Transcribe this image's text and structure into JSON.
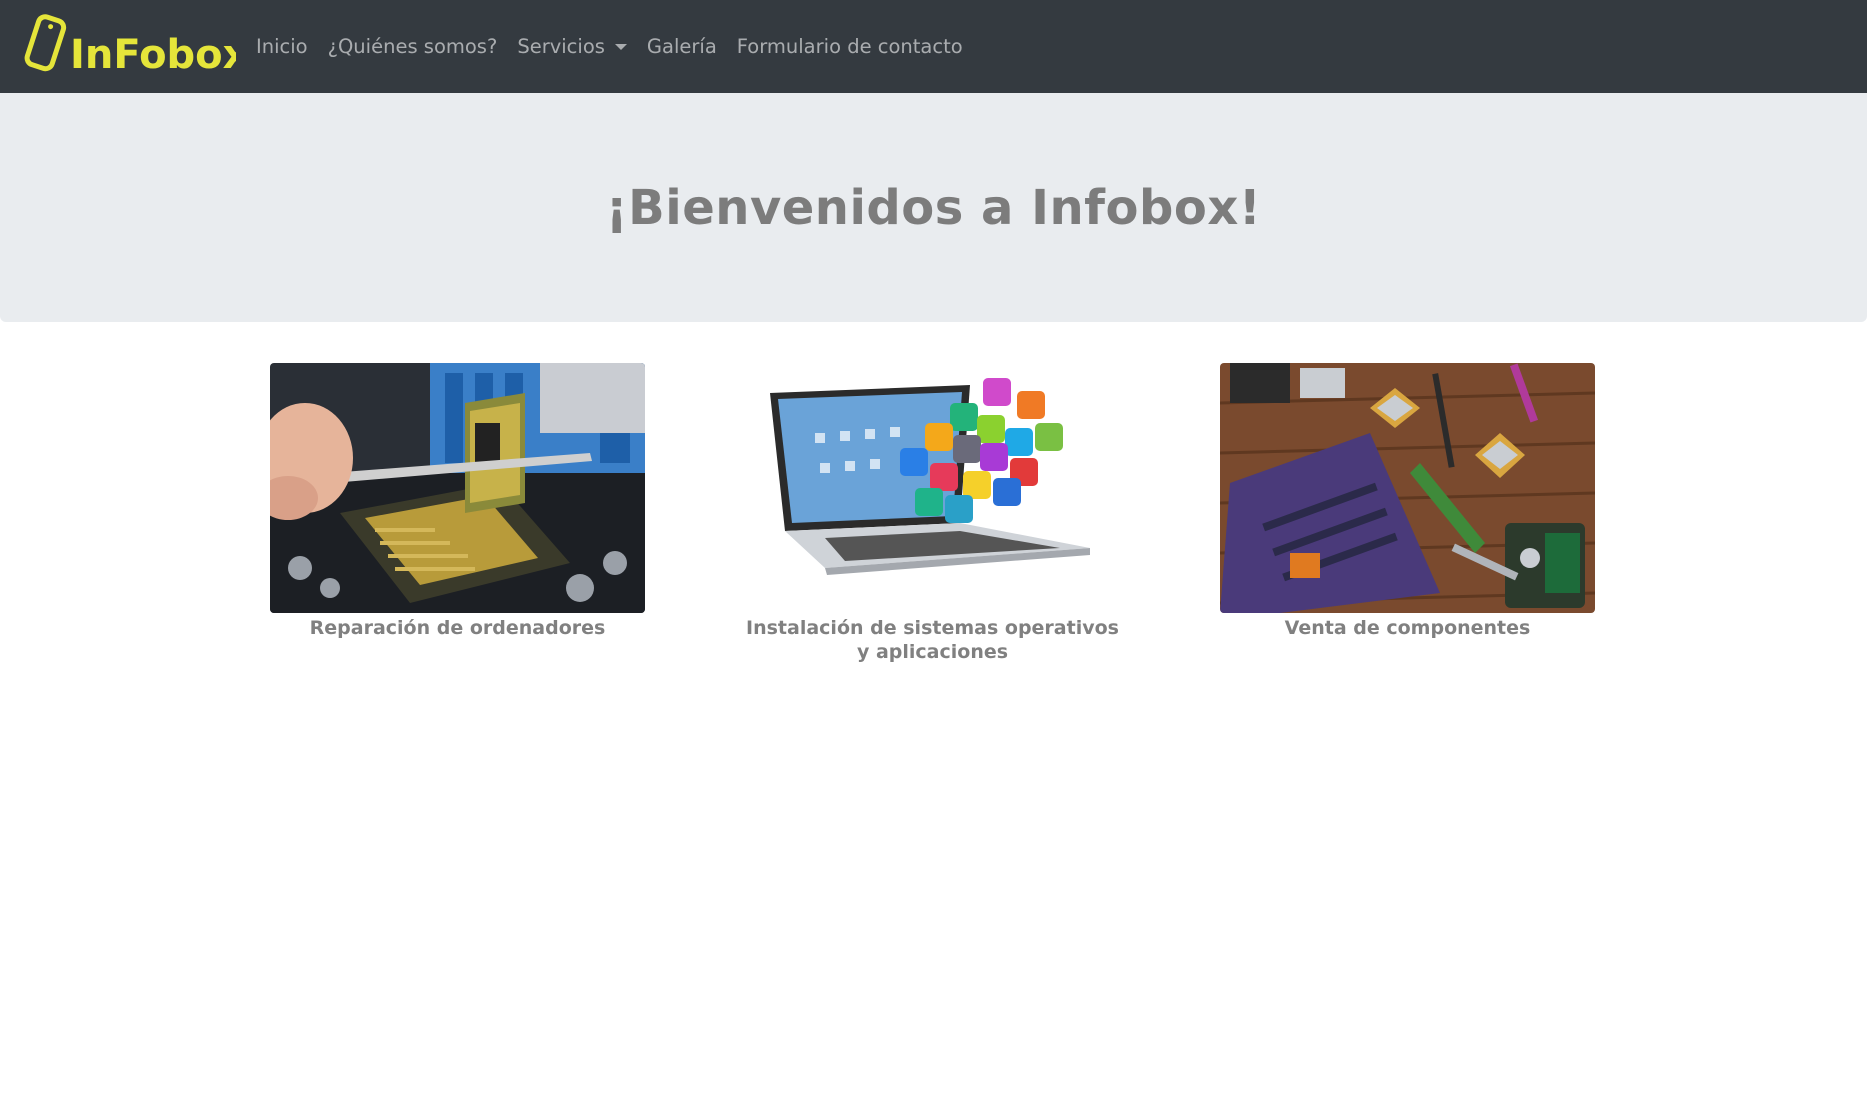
{
  "brand": {
    "name": "Infobox",
    "color": "#e5e53a"
  },
  "nav": {
    "items": [
      {
        "label": "Inicio"
      },
      {
        "label": "¿Quiénes somos?"
      },
      {
        "label": "Servicios",
        "dropdown": true
      },
      {
        "label": "Galería"
      },
      {
        "label": "Formulario de contacto"
      }
    ]
  },
  "hero": {
    "title": "¡Bienvenidos a Infobox!"
  },
  "services": [
    {
      "caption": "Reparación de ordenadores",
      "image": "cpu-repair-photo"
    },
    {
      "caption": "Instalación de sistemas operativos y aplicaciones",
      "image": "laptop-apps-photo"
    },
    {
      "caption": "Venta de componentes",
      "image": "components-photo"
    }
  ],
  "colors": {
    "navbar": "#343a40",
    "jumbotron": "#e9ecef",
    "text_muted": "#808080"
  }
}
